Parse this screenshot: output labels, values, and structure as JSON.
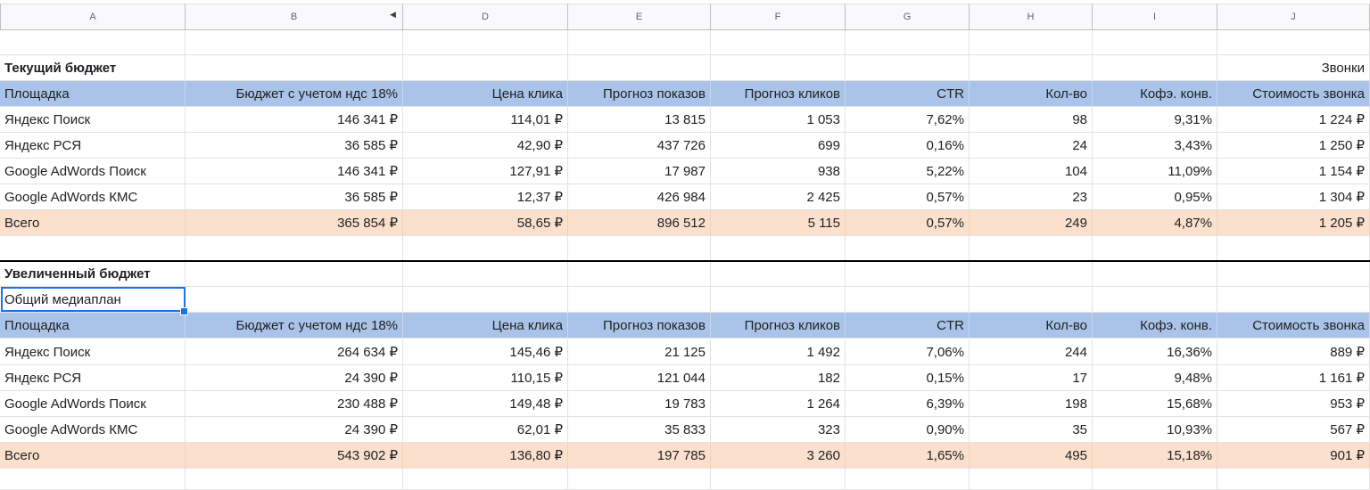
{
  "columns": [
    "A",
    "B",
    "C_hidden",
    "D",
    "E",
    "F",
    "G",
    "H",
    "I",
    "J"
  ],
  "column_letters": {
    "A": "A",
    "B": "B",
    "D": "D",
    "E": "E",
    "F": "F",
    "G": "G",
    "H": "H",
    "I": "I",
    "J": "J"
  },
  "hidden_column_arrows": {
    "left": "◀",
    "right": "▶"
  },
  "current": {
    "title": "Текущий бюджет",
    "calls_label": "Звонки",
    "headers": [
      "Площадка",
      "Бюджет с учетом ндс 18%",
      "Цена клика",
      "Прогноз показов",
      "Прогноз кликов",
      "CTR",
      "Кол-во",
      "Кофэ. конв.",
      "Стоимость звонка"
    ],
    "rows": [
      [
        "Яндекс Поиск",
        "146 341 ₽",
        "114,01 ₽",
        "13 815",
        "1 053",
        "7,62%",
        "98",
        "9,31%",
        "1 224 ₽"
      ],
      [
        "Яндекс РСЯ",
        "36 585 ₽",
        "42,90 ₽",
        "437 726",
        "699",
        "0,16%",
        "24",
        "3,43%",
        "1 250 ₽"
      ],
      [
        "Google AdWords Поиск",
        "146 341 ₽",
        "127,91 ₽",
        "17 987",
        "938",
        "5,22%",
        "104",
        "11,09%",
        "1 154 ₽"
      ],
      [
        "Google AdWords КМС",
        "36 585 ₽",
        "12,37 ₽",
        "426 984",
        "2 425",
        "0,57%",
        "23",
        "0,95%",
        "1 304 ₽"
      ]
    ],
    "total": [
      "Всего",
      "365 854 ₽",
      "58,65 ₽",
      "896 512",
      "5 115",
      "0,57%",
      "249",
      "4,87%",
      "1 205 ₽"
    ]
  },
  "increased": {
    "title": "Увеличенный бюджет",
    "subtitle": "Общий медиаплан",
    "headers": [
      "Площадка",
      "Бюджет с учетом ндс 18%",
      "Цена клика",
      "Прогноз показов",
      "Прогноз кликов",
      "CTR",
      "Кол-во",
      "Кофэ. конв.",
      "Стоимость звонка"
    ],
    "rows": [
      [
        "Яндекс Поиск",
        "264 634 ₽",
        "145,46 ₽",
        "21 125",
        "1 492",
        "7,06%",
        "244",
        "16,36%",
        "889 ₽"
      ],
      [
        "Яндекс РСЯ",
        "24 390 ₽",
        "110,15 ₽",
        "121 044",
        "182",
        "0,15%",
        "17",
        "9,48%",
        "1 161 ₽"
      ],
      [
        "Google AdWords Поиск",
        "230 488 ₽",
        "149,48 ₽",
        "19 783",
        "1 264",
        "6,39%",
        "198",
        "15,68%",
        "953 ₽"
      ],
      [
        "Google AdWords КМС",
        "24 390 ₽",
        "62,01 ₽",
        "35 833",
        "323",
        "0,90%",
        "35",
        "10,93%",
        "567 ₽"
      ]
    ],
    "total": [
      "Всего",
      "543 902 ₽",
      "136,80 ₽",
      "197 785",
      "3 260",
      "1,65%",
      "495",
      "15,18%",
      "901 ₽"
    ]
  },
  "colors": {
    "header_fill": "#a9c4e8",
    "total_fill": "#fbe1cd",
    "selection": "#1a73e8"
  }
}
